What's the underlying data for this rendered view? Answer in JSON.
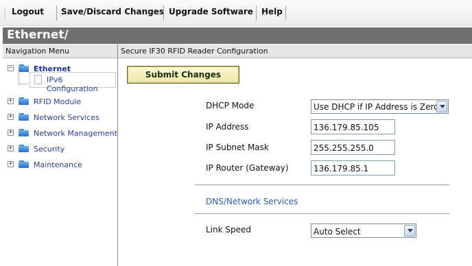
{
  "toolbar": {
    "logout": "Logout",
    "save_discard": "Save/Discard Changes",
    "upgrade": "Upgrade Software",
    "help": "Help"
  },
  "title_bar": {
    "title": "Ethernet/"
  },
  "nav": {
    "header": "Navigation Menu",
    "items": [
      {
        "label": "Ethernet",
        "expander": "−",
        "icon": "folder-icon",
        "selected": true
      },
      {
        "label": "RFID Module",
        "expander": "+",
        "icon": "folder-icon"
      },
      {
        "label": "Network Services",
        "expander": "+",
        "icon": "folder-icon"
      },
      {
        "label": "Network Management",
        "expander": "+",
        "icon": "folder-icon"
      },
      {
        "label": "Security",
        "expander": "+",
        "icon": "folder-icon"
      },
      {
        "label": "Maintenance",
        "expander": "+",
        "icon": "folder-icon"
      }
    ],
    "child": {
      "label": "IPv6 Configuration",
      "icon": "page-icon"
    }
  },
  "main": {
    "header": "Secure IF30 RFID Reader Configuration",
    "submit_label": "Submit Changes",
    "fields": {
      "dhcp_mode": {
        "label": "DHCP Mode",
        "value": "Use DHCP if IP Address is Zero"
      },
      "ip_address": {
        "label": "IP Address",
        "value": "136.179.85.105"
      },
      "subnet_mask": {
        "label": "IP Subnet Mask",
        "value": "255.255.255.0"
      },
      "router": {
        "label": "IP Router (Gateway)",
        "value": "136.179.85.1"
      }
    },
    "dns_section_title": "DNS/Network Services",
    "link_speed": {
      "label": "Link Speed",
      "value": "Auto Select"
    }
  },
  "colors": {
    "title_bar_bg": "#6f6f6f",
    "nav_link": "#2a3f8f",
    "section_title": "#2b5aa8",
    "submit_bg": "#f3eebb"
  }
}
